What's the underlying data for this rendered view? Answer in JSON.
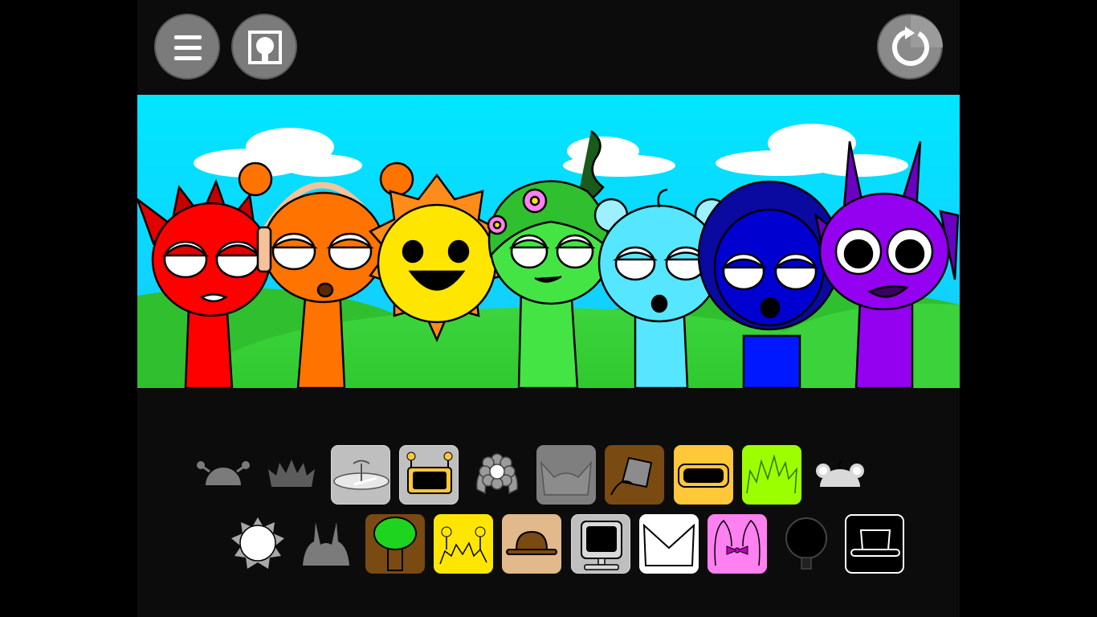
{
  "toolbar": {
    "menu": {
      "icon": "hamburger-menu-icon"
    },
    "character_select": {
      "icon": "character-portrait-icon"
    },
    "reset": {
      "icon": "reset-icon"
    }
  },
  "scene": {
    "characters": [
      {
        "name": "red-horned-character",
        "color": "#ff0000"
      },
      {
        "name": "orange-headphones-character",
        "color": "#ff7300"
      },
      {
        "name": "yellow-sun-character",
        "color": "#ffe600"
      },
      {
        "name": "green-leaf-character",
        "color": "#45e445"
      },
      {
        "name": "cyan-bear-character",
        "color": "#57e6ff"
      },
      {
        "name": "blue-hooded-character",
        "color": "#0000d0"
      },
      {
        "name": "purple-horned-character",
        "color": "#9400f0"
      }
    ]
  },
  "palette": {
    "row1": [
      {
        "icon": "antenna-hat-icon",
        "active": false,
        "bg": null
      },
      {
        "icon": "spiky-crown-icon",
        "active": false,
        "bg": null
      },
      {
        "icon": "fan-hat-icon",
        "active": true,
        "bg": "#bfbfbf"
      },
      {
        "icon": "robot-screen-icon",
        "active": true,
        "bg": "#bfbfbf"
      },
      {
        "icon": "flower-dreads-icon",
        "active": false,
        "bg": null
      },
      {
        "icon": "cat-ears-icon",
        "active": true,
        "bg": "#7f7f7f"
      },
      {
        "icon": "bucket-hat-icon",
        "active": true,
        "bg": "#7a4a13"
      },
      {
        "icon": "visor-icon",
        "active": true,
        "bg": "#ffc73a"
      },
      {
        "icon": "grass-hair-icon",
        "active": true,
        "bg": "#9cff00"
      },
      {
        "icon": "bear-ears-icon",
        "active": false,
        "bg": null
      }
    ],
    "row2": [
      {
        "icon": "sun-rays-icon",
        "active": false,
        "bg": null
      },
      {
        "icon": "horns-icon",
        "active": false,
        "bg": null
      },
      {
        "icon": "tree-icon",
        "active": true,
        "bg": "#7a4a13"
      },
      {
        "icon": "antenna-hair-icon",
        "active": true,
        "bg": "#ffe600"
      },
      {
        "icon": "bowler-hat-icon",
        "active": true,
        "bg": "#e2b98a"
      },
      {
        "icon": "computer-monitor-icon",
        "active": true,
        "bg": "#bfbfbf"
      },
      {
        "icon": "envelope-icon",
        "active": true,
        "bg": "#ffffff"
      },
      {
        "icon": "bow-ears-icon",
        "active": true,
        "bg": "#ff80f0"
      },
      {
        "icon": "black-orb-icon",
        "active": false,
        "bg": null
      },
      {
        "icon": "top-hat-icon",
        "active": true,
        "bg": "#000000"
      }
    ]
  }
}
